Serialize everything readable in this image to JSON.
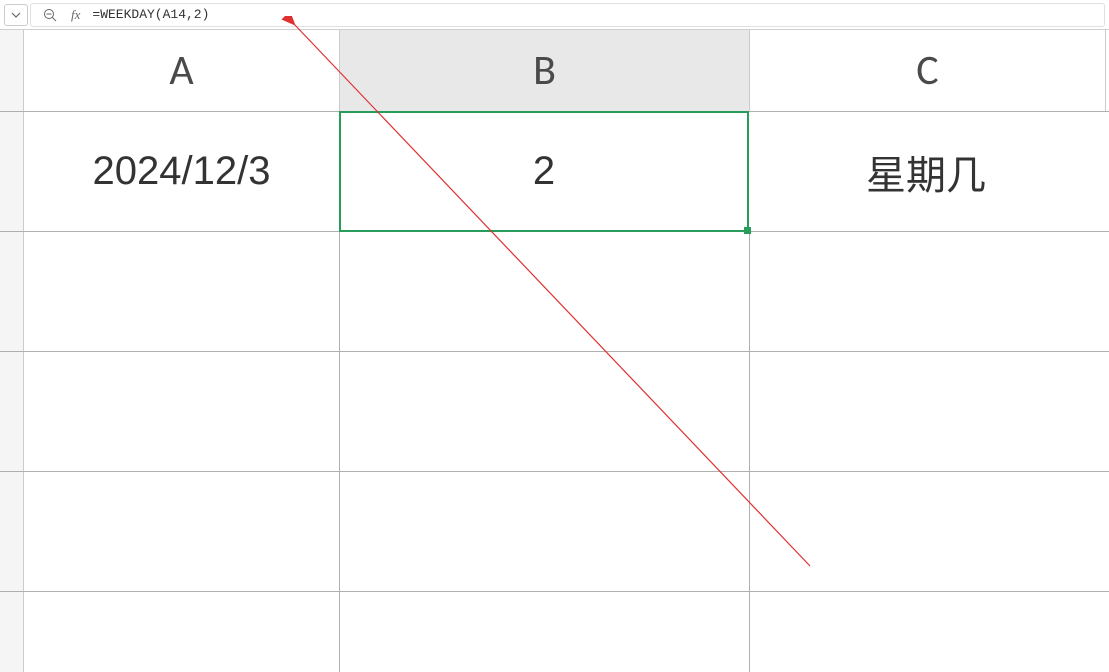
{
  "formula_bar": {
    "fx_label": "fx",
    "formula": "=WEEKDAY(A14,2)"
  },
  "columns": {
    "a": "A",
    "b": "B",
    "c": "C"
  },
  "cells": {
    "a1": "2024/12/3",
    "b1": "2",
    "c1": "星期几"
  },
  "selected_cell": "B1"
}
